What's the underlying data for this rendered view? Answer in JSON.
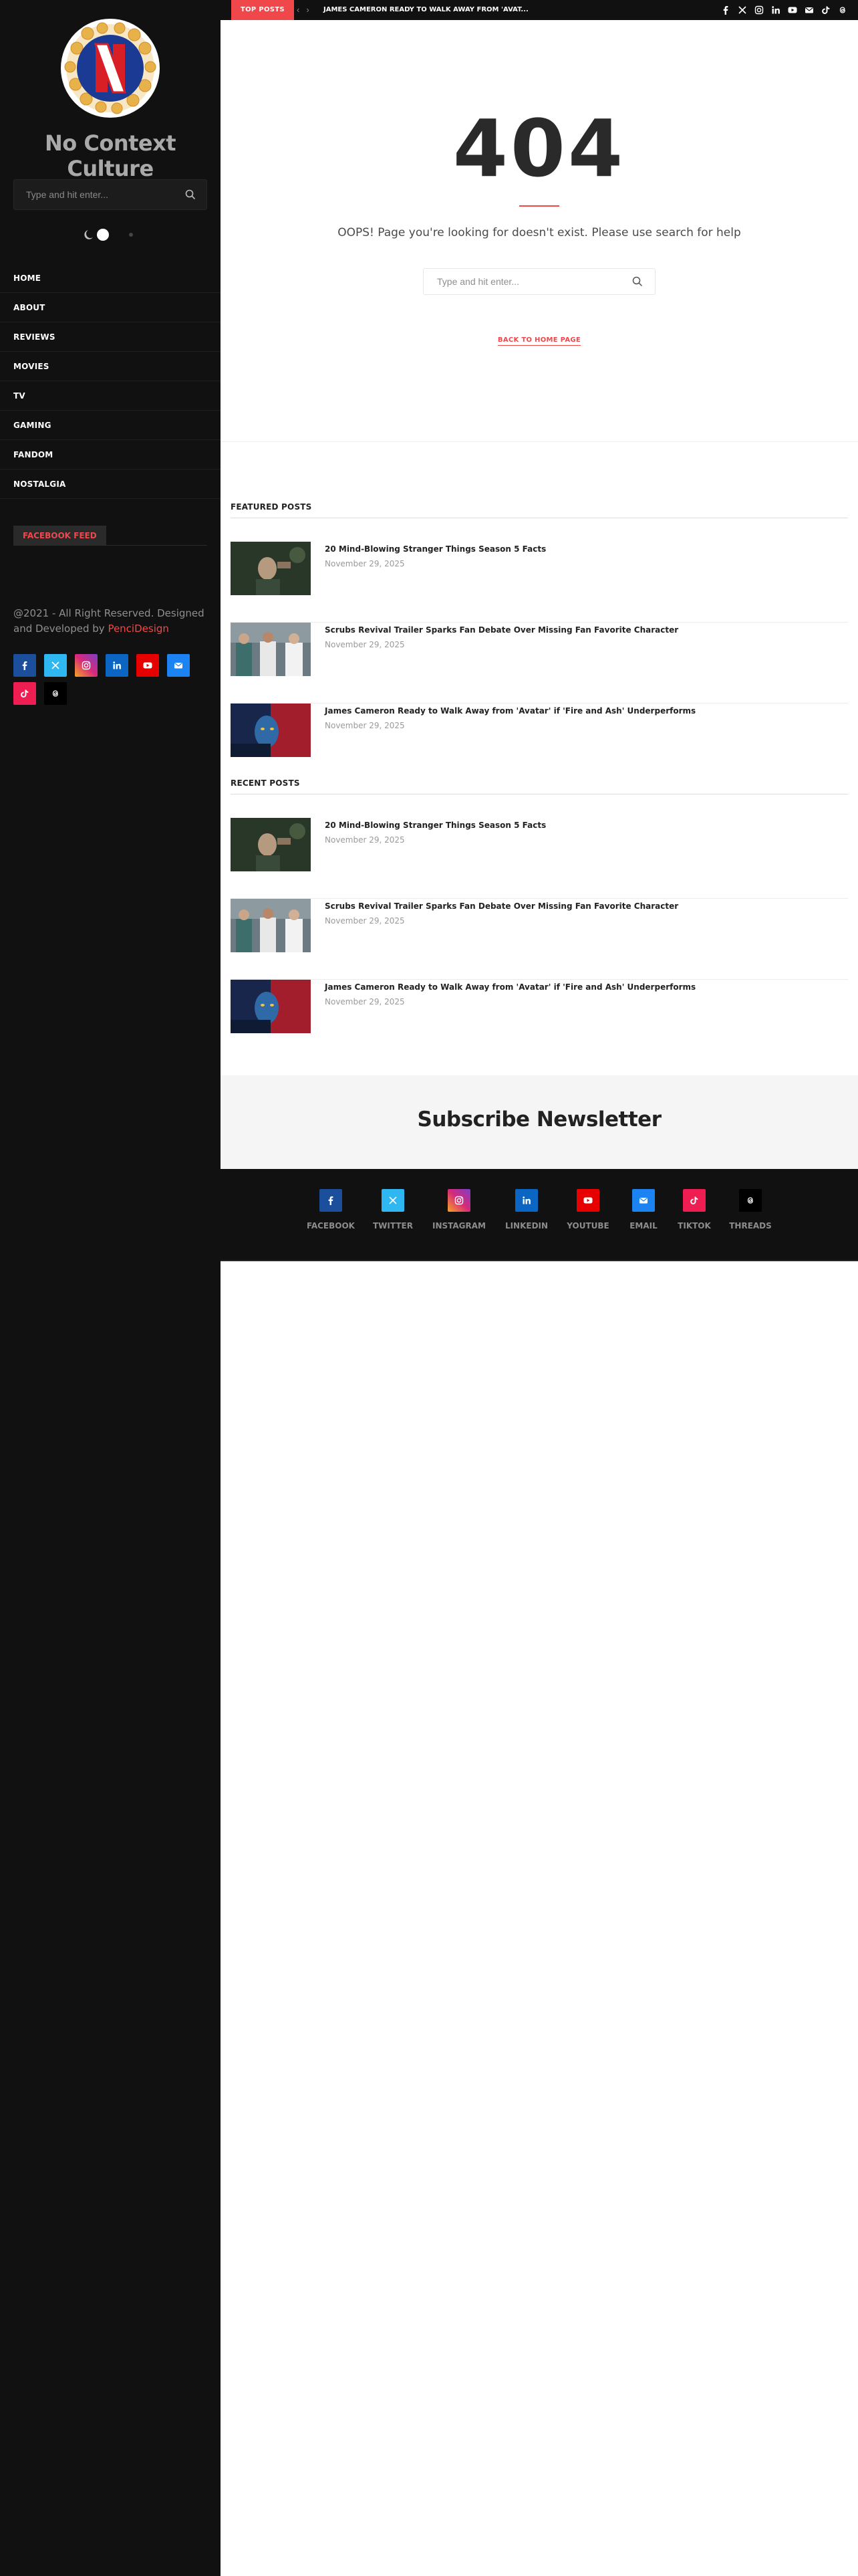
{
  "site": {
    "title": "No Context Culture",
    "logo_letter": "N",
    "search_placeholder": "Type and hit enter..."
  },
  "nav": [
    "HOME",
    "ABOUT",
    "REVIEWS",
    "MOVIES",
    "TV",
    "GAMING",
    "FANDOM",
    "NOSTALGIA"
  ],
  "sidebar": {
    "facebook_feed": "FACEBOOK FEED",
    "copyright_prefix": "@2021 - All Right Reserved. Designed and Developed by ",
    "copyright_brand": "PenciDesign"
  },
  "topbar": {
    "label": "TOP POSTS",
    "headline": "JAMES CAMERON READY TO WALK AWAY FROM 'AVAT..."
  },
  "error": {
    "code": "404",
    "message": "OOPS! Page you're looking for doesn't exist. Please use search for help",
    "search_placeholder": "Type and hit enter...",
    "back_home": "BACK TO HOME PAGE"
  },
  "featured": {
    "title": "FEATURED POSTS",
    "posts": [
      {
        "title": "20 Mind-Blowing Stranger Things Season 5 Facts",
        "date": "November 29, 2025"
      },
      {
        "title": "Scrubs Revival Trailer Sparks Fan Debate Over Missing Fan Favorite Character",
        "date": "November 29, 2025"
      },
      {
        "title": "James Cameron Ready to Walk Away from 'Avatar' if 'Fire and Ash' Underperforms",
        "date": "November 29, 2025"
      }
    ]
  },
  "recent": {
    "title": "RECENT POSTS",
    "posts": [
      {
        "title": "20 Mind-Blowing Stranger Things Season 5 Facts",
        "date": "November 29, 2025"
      },
      {
        "title": "Scrubs Revival Trailer Sparks Fan Debate Over Missing Fan Favorite Character",
        "date": "November 29, 2025"
      },
      {
        "title": "James Cameron Ready to Walk Away from 'Avatar' if 'Fire and Ash' Underperforms",
        "date": "November 29, 2025"
      }
    ]
  },
  "newsletter": {
    "title": "Subscribe Newsletter"
  },
  "footer_socials": [
    {
      "label": "FACEBOOK",
      "icon": "facebook-icon",
      "color": "#1b4e9b"
    },
    {
      "label": "TWITTER",
      "icon": "x-twitter-icon",
      "color": "#2eb7f0"
    },
    {
      "label": "INSTAGRAM",
      "icon": "instagram-icon",
      "color": "#9b3bc2"
    },
    {
      "label": "LINKEDIN",
      "icon": "linkedin-icon",
      "color": "#0a66c2"
    },
    {
      "label": "YOUTUBE",
      "icon": "youtube-icon",
      "color": "#e60000"
    },
    {
      "label": "EMAIL",
      "icon": "email-icon",
      "color": "#1c84f2"
    },
    {
      "label": "TIKTOK",
      "icon": "tiktok-icon",
      "color": "#ee1d52"
    },
    {
      "label": "THREADS",
      "icon": "threads-icon",
      "color": "#000000"
    }
  ],
  "colors": {
    "accent": "#f0474b",
    "sidebar_bg": "#111111",
    "newsletter_bg": "#f5f5f5"
  }
}
